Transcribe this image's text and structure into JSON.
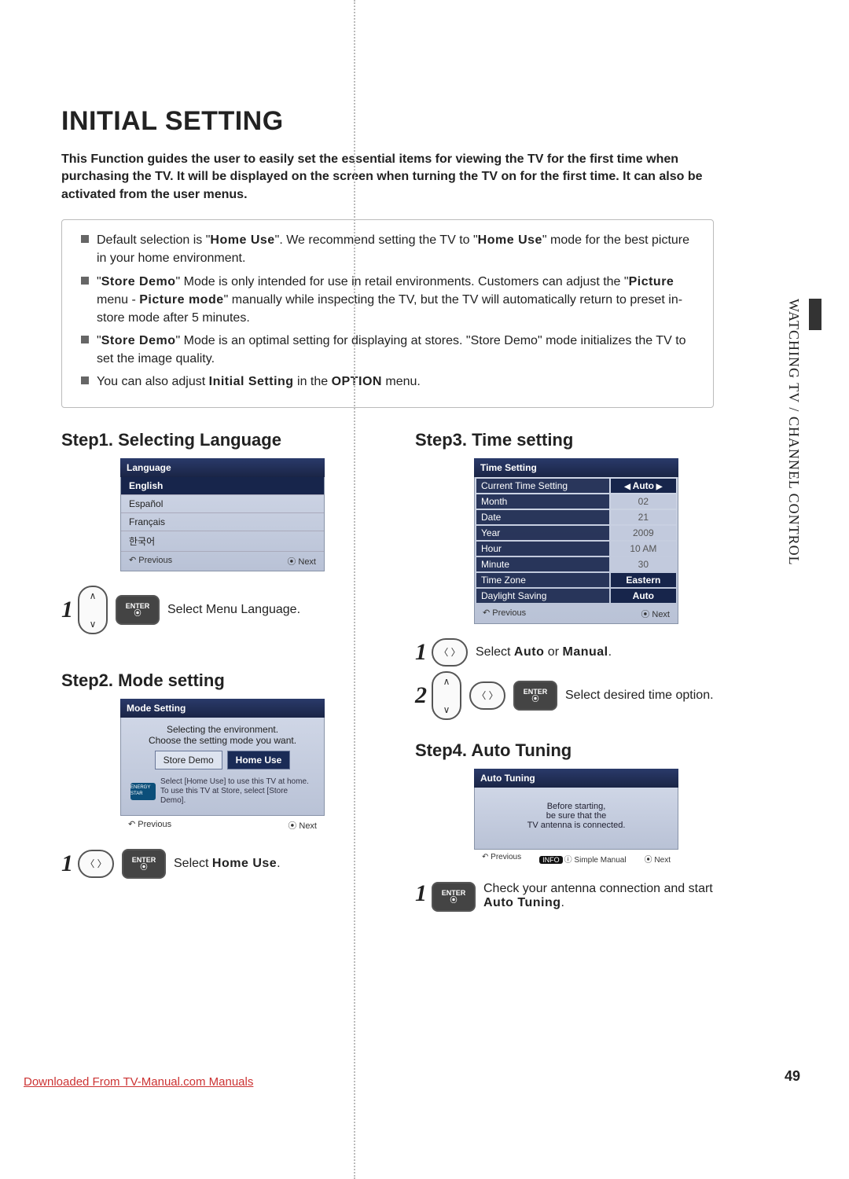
{
  "page": {
    "title": "INITIAL SETTING",
    "side_tab": "WATCHING TV / CHANNEL CONTROL",
    "page_number": "49",
    "footer_link": "Downloaded From TV-Manual.com Manuals",
    "intro": "This Function guides the user to easily set the essential items for viewing the TV for the first time when purchasing the TV. It will be displayed on the screen when turning the TV on for the first time. It can also be activated from the user menus."
  },
  "notes": {
    "b1_a": "Default selection is \"",
    "b1_home": "Home Use",
    "b1_b": "\". We recommend setting the TV to \"",
    "b1_c": "\" mode for the best picture in your home environment.",
    "b2_a": "\"",
    "b2_store": "Store Demo",
    "b2_b": "\" Mode is only intended for use in retail environments. Customers can adjust the \"",
    "b2_pic": "Picture",
    "b2_c": " menu - ",
    "b2_pm": "Picture mode",
    "b2_d": "\" manually while inspecting the TV, but the TV will automatically return to preset in-store mode after 5 minutes.",
    "b3_a": "\"",
    "b3_b": "\" Mode is an optimal setting for displaying at stores. \"Store Demo\" mode initializes the TV to set the image quality.",
    "b4_a": "You can also adjust ",
    "b4_is": "Initial Setting",
    "b4_b": " in the ",
    "b4_opt": "OPTION",
    "b4_c": " menu."
  },
  "step1": {
    "head": "Step1. Selecting Language",
    "title": "Language",
    "items": [
      "English",
      "Español",
      "Français",
      "한국어"
    ],
    "prev": "Previous",
    "next": "Next",
    "instr": "Select Menu Language."
  },
  "step2": {
    "head": "Step2. Mode setting",
    "title": "Mode Setting",
    "line1": "Selecting the environment.",
    "line2": "Choose the setting mode you want.",
    "opt_store": "Store Demo",
    "opt_home": "Home Use",
    "tiny": "Select [Home Use] to use this TV at home. To use this TV at Store, select [Store Demo].",
    "es": "ENERGY STAR",
    "prev": "Previous",
    "next": "Next",
    "instr_a": "Select ",
    "instr_home": "Home Use",
    "instr_b": "."
  },
  "step3": {
    "head": "Step3. Time setting",
    "title": "Time Setting",
    "rows": [
      {
        "label": "Current Time Setting",
        "value": "Auto",
        "hl": true,
        "arrows": true
      },
      {
        "label": "Month",
        "value": "02"
      },
      {
        "label": "Date",
        "value": "21"
      },
      {
        "label": "Year",
        "value": "2009"
      },
      {
        "label": "Hour",
        "value": "10 AM"
      },
      {
        "label": "Minute",
        "value": "30"
      },
      {
        "label": "Time Zone",
        "value": "Eastern",
        "hl": true
      },
      {
        "label": "Daylight Saving",
        "value": "Auto",
        "hl": true
      }
    ],
    "prev": "Previous",
    "next": "Next",
    "instr1_a": "Select ",
    "instr1_auto": "Auto",
    "instr1_or": " or ",
    "instr1_man": "Manual",
    "instr1_b": ".",
    "instr2": "Select desired time option."
  },
  "step4": {
    "head": "Step4. Auto Tuning",
    "title": "Auto Tuning",
    "msg1": "Before starting,",
    "msg2": "be sure that the",
    "msg3": "TV antenna is connected.",
    "prev": "Previous",
    "info": "INFO",
    "simple": "Simple Manual",
    "next": "Next",
    "instr_a": "Check your antenna connection and start ",
    "instr_at": "Auto Tuning",
    "instr_b": "."
  },
  "remote": {
    "enter": "ENTER"
  }
}
